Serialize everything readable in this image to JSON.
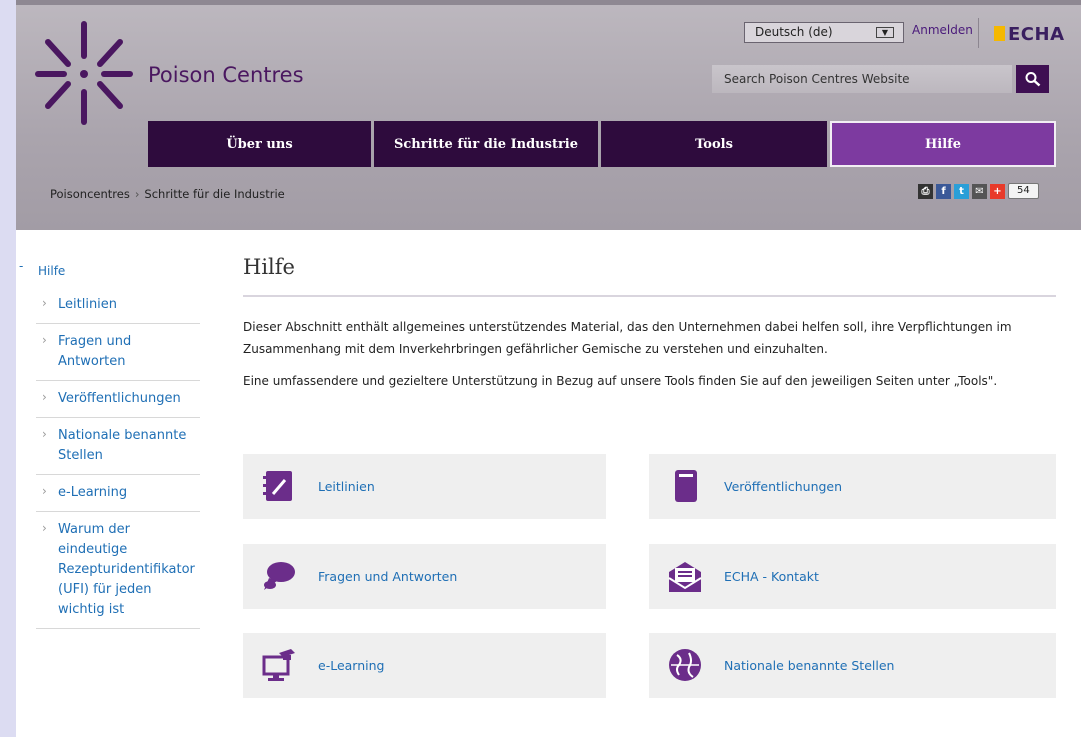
{
  "site": {
    "title": "Poison Centres"
  },
  "top_bar": {
    "language_selected": "Deutsch (de)",
    "login_label": "Anmelden",
    "echa_logo_text": "ECHA",
    "search_placeholder": "Search Poison Centres Website"
  },
  "nav": {
    "items": [
      {
        "label": "Über uns"
      },
      {
        "label": "Schritte für die Industrie"
      },
      {
        "label": "Tools"
      },
      {
        "label": "Hilfe"
      }
    ]
  },
  "breadcrumb": {
    "items": [
      "Poisoncentres",
      "Schritte für die Industrie"
    ]
  },
  "share": {
    "count": "54"
  },
  "sidebar": {
    "root_label": "Hilfe",
    "items": [
      {
        "label": "Leitlinien"
      },
      {
        "label": "Fragen und Antworten"
      },
      {
        "label": "Veröffentlichungen"
      },
      {
        "label": "Nationale benannte Stellen"
      },
      {
        "label": "e-Learning"
      },
      {
        "label": "Warum der eindeutige Rezepturidentifikator (UFI) für jeden wichtig ist"
      }
    ]
  },
  "main": {
    "title": "Hilfe",
    "paragraphs": [
      "Dieser Abschnitt enthält allgemeines unterstützendes Material, das den Unternehmen dabei helfen soll, ihre Verpflichtungen im Zusammenhang mit dem Inverkehrbringen gefährlicher Gemische zu verstehen und einzuhalten.",
      "Eine umfassendere und gezieltere Unterstützung in Bezug auf unsere Tools finden Sie auf den jeweiligen Seiten unter „Tools\"."
    ],
    "cards": [
      {
        "label": "Leitlinien",
        "icon": "guidance-book-icon"
      },
      {
        "label": "Veröffentlichungen",
        "icon": "publication-book-icon"
      },
      {
        "label": "Fragen und Antworten",
        "icon": "speech-bubble-icon"
      },
      {
        "label": "ECHA - Kontakt",
        "icon": "mail-envelope-icon"
      },
      {
        "label": "e-Learning",
        "icon": "monitor-graduation-cap-icon"
      },
      {
        "label": "Nationale benannte Stellen",
        "icon": "globe-icon"
      }
    ]
  },
  "colors": {
    "brand_purple": "#4a1760",
    "nav_dark": "#2e0b3d",
    "nav_active": "#7d3aa0",
    "link_blue": "#1f6fb5",
    "icon_purple": "#6b2d8a"
  }
}
